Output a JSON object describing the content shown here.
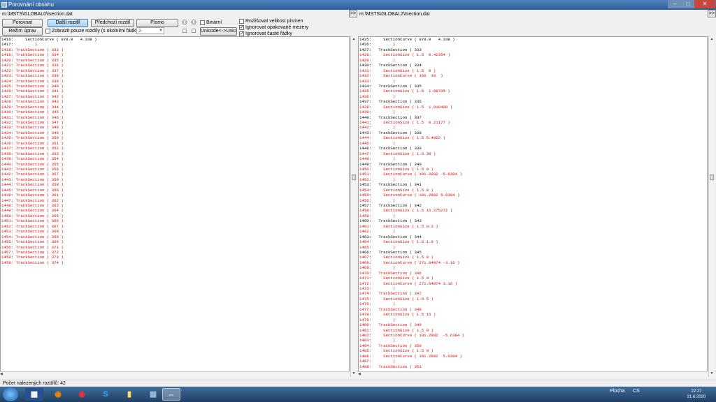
{
  "window": {
    "title": "Porovnání obsahu",
    "minimize": "–",
    "maximize": "□",
    "close": "✕"
  },
  "paths": {
    "left": "m:\\MSTS\\GLOBAL0\\tsection.dat",
    "right": "m:\\MSTS\\GLOBAL2\\tsection.dat",
    "arrow_label": ">>"
  },
  "toolbar": {
    "compare": "Porovnat",
    "next_diff": "Další rozdíl",
    "prev_diff": "Předchozí rozdíl",
    "font": "Písmo",
    "edit_mode": "Režim úprav",
    "unicode": "Unicode<->Unicode",
    "binary": "Binární",
    "only_diff": "Zobrazit pouze rozdíly (s okolními řádky)",
    "context_value": "2",
    "case_sensitive": "Rozlišovat velikost písmen",
    "ignore_spaces": "Ignorovat opakované mezery",
    "ignore_lines": "Ignorovat časté řádky"
  },
  "checks": {
    "binary": false,
    "only_diff": false,
    "case_sensitive": false,
    "ignore_spaces": true,
    "ignore_lines": true
  },
  "left_lines": [
    {
      "n": "1416:",
      "t": "    SectionCurve ( 870.0   4.338 )",
      "d": false
    },
    {
      "n": "1417:",
      "t": "        )",
      "d": false
    },
    {
      "n": "1418:",
      "t": "TrackSection ( 333 )",
      "d": true
    },
    {
      "n": "1419:",
      "t": "TrackSection ( 334 )",
      "d": true
    },
    {
      "n": "1420:",
      "t": "TrackSection ( 335 )",
      "d": true
    },
    {
      "n": "1421:",
      "t": "TrackSection ( 336 )",
      "d": true
    },
    {
      "n": "1422:",
      "t": "TrackSection ( 337 )",
      "d": true
    },
    {
      "n": "1423:",
      "t": "TrackSection ( 338 )",
      "d": true
    },
    {
      "n": "1424:",
      "t": "TrackSection ( 339 )",
      "d": true
    },
    {
      "n": "1425:",
      "t": "TrackSection ( 340 )",
      "d": true
    },
    {
      "n": "1426:",
      "t": "TrackSection ( 341 )",
      "d": true
    },
    {
      "n": "1427:",
      "t": "TrackSection ( 342 )",
      "d": true
    },
    {
      "n": "1428:",
      "t": "TrackSection ( 343 )",
      "d": true
    },
    {
      "n": "1429:",
      "t": "TrackSection ( 344 )",
      "d": true
    },
    {
      "n": "1430:",
      "t": "TrackSection ( 345 )",
      "d": true
    },
    {
      "n": "1431:",
      "t": "TrackSection ( 346 )",
      "d": true
    },
    {
      "n": "1432:",
      "t": "TrackSection ( 347 )",
      "d": true
    },
    {
      "n": "1433:",
      "t": "TrackSection ( 348 )",
      "d": true
    },
    {
      "n": "1434:",
      "t": "TrackSection ( 349 )",
      "d": true
    },
    {
      "n": "1435:",
      "t": "TrackSection ( 350 )",
      "d": true
    },
    {
      "n": "1436:",
      "t": "TrackSection ( 351 )",
      "d": true
    },
    {
      "n": "1437:",
      "t": "TrackSection ( 352 )",
      "d": true
    },
    {
      "n": "1438:",
      "t": "TrackSection ( 353 )",
      "d": true
    },
    {
      "n": "1439:",
      "t": "TrackSection ( 354 )",
      "d": true
    },
    {
      "n": "1440:",
      "t": "TrackSection ( 355 )",
      "d": true
    },
    {
      "n": "1441:",
      "t": "TrackSection ( 356 )",
      "d": true
    },
    {
      "n": "1442:",
      "t": "TrackSection ( 357 )",
      "d": true
    },
    {
      "n": "1443:",
      "t": "TrackSection ( 358 )",
      "d": true
    },
    {
      "n": "1444:",
      "t": "TrackSection ( 359 )",
      "d": true
    },
    {
      "n": "1445:",
      "t": "TrackSection ( 360 )",
      "d": true
    },
    {
      "n": "1446:",
      "t": "TrackSection ( 361 )",
      "d": true
    },
    {
      "n": "1447:",
      "t": "TrackSection ( 362 )",
      "d": true
    },
    {
      "n": "1448:",
      "t": "TrackSection ( 363 )",
      "d": true
    },
    {
      "n": "1449:",
      "t": "TrackSection ( 364 )",
      "d": true
    },
    {
      "n": "1450:",
      "t": "TrackSection ( 365 )",
      "d": true
    },
    {
      "n": "1451:",
      "t": "TrackSection ( 366 )",
      "d": true
    },
    {
      "n": "1452:",
      "t": "TrackSection ( 367 )",
      "d": true
    },
    {
      "n": "1453:",
      "t": "TrackSection ( 368 )",
      "d": true
    },
    {
      "n": "1454:",
      "t": "TrackSection ( 369 )",
      "d": true
    },
    {
      "n": "1455:",
      "t": "TrackSection ( 360 )",
      "d": true
    },
    {
      "n": "1456:",
      "t": "TrackSection ( 371 )",
      "d": true
    },
    {
      "n": "1457:",
      "t": "TrackSection ( 372 )",
      "d": true
    },
    {
      "n": "1458:",
      "t": "TrackSection ( 373 )",
      "d": true
    },
    {
      "n": "1459:",
      "t": "TrackSection ( 374 )",
      "d": true
    }
  ],
  "right_lines": [
    {
      "n": "1425:",
      "t": "    SectionCurve ( 870.0   4.338 )",
      "d": false
    },
    {
      "n": "1426:",
      "t": "        )",
      "d": false
    },
    {
      "n": "1427:",
      "t": "  TrackSection ( 333",
      "d": false
    },
    {
      "n": "1428:",
      "t": "    SectionSize ( 1.5  0.42354 )",
      "d": true
    },
    {
      "n": "1429:",
      "t": "        )",
      "d": true
    },
    {
      "n": "1430:",
      "t": "  TrackSection ( 334",
      "d": false
    },
    {
      "n": "1431:",
      "t": "    SectionSize ( 1.5  0 )",
      "d": true
    },
    {
      "n": "1432:",
      "t": "    SectionCurve ( 160  10  )",
      "d": true
    },
    {
      "n": "1433:",
      "t": "        )",
      "d": true
    },
    {
      "n": "1434:",
      "t": "  TrackSection ( 335",
      "d": false
    },
    {
      "n": "1435:",
      "t": "    SectionSize ( 1.5  1.08705 )",
      "d": true
    },
    {
      "n": "1436:",
      "t": "        )",
      "d": true
    },
    {
      "n": "1437:",
      "t": "  TrackSection ( 336",
      "d": false
    },
    {
      "n": "1438:",
      "t": "    SectionSize ( 1.5  1.019408 )",
      "d": true
    },
    {
      "n": "1439:",
      "t": "        )",
      "d": true
    },
    {
      "n": "1440:",
      "t": "  TrackSection ( 337",
      "d": false
    },
    {
      "n": "1441:",
      "t": "    SectionSize ( 1.5  0.21177 )",
      "d": true
    },
    {
      "n": "1442:",
      "t": "        )",
      "d": true
    },
    {
      "n": "1443:",
      "t": "  TrackSection ( 338",
      "d": false
    },
    {
      "n": "1444:",
      "t": "    SectionSize ( 1.5 5.4922 )",
      "d": true
    },
    {
      "n": "1445:",
      "t": "        )",
      "d": true
    },
    {
      "n": "1446:",
      "t": "  TrackSection ( 339",
      "d": false
    },
    {
      "n": "1447:",
      "t": "    SectionSize ( 1.5 30 )",
      "d": true
    },
    {
      "n": "1448:",
      "t": "        )",
      "d": true
    },
    {
      "n": "1449:",
      "t": "  TrackSection ( 340",
      "d": false
    },
    {
      "n": "1450:",
      "t": "    SectionSize ( 1.5 0 )",
      "d": true
    },
    {
      "n": "1451:",
      "t": "    SectionCurve ( 101.2882 -5.6384 )",
      "d": true
    },
    {
      "n": "1452:",
      "t": "        )",
      "d": true
    },
    {
      "n": "1453:",
      "t": "  TrackSection ( 341",
      "d": false
    },
    {
      "n": "1454:",
      "t": "    SectionSize ( 1.5 0 )",
      "d": true
    },
    {
      "n": "1455:",
      "t": "    SectionCurve ( 101.2882 5.6384 )",
      "d": true
    },
    {
      "n": "1456:",
      "t": "        )",
      "d": true
    },
    {
      "n": "1457:",
      "t": "  TrackSection ( 342",
      "d": false
    },
    {
      "n": "1458:",
      "t": "    SectionSize ( 1.5 15.275272 )",
      "d": true
    },
    {
      "n": "1459:",
      "t": "        )",
      "d": true
    },
    {
      "n": "1460:",
      "t": "  TrackSection ( 343",
      "d": false
    },
    {
      "n": "1461:",
      "t": "    SectionSize ( 1.5 0.3 )",
      "d": true
    },
    {
      "n": "1462:",
      "t": "        )",
      "d": true
    },
    {
      "n": "1463:",
      "t": "  TrackSection ( 344",
      "d": false
    },
    {
      "n": "1464:",
      "t": "    SectionSize ( 1.5 1.0 )",
      "d": true
    },
    {
      "n": "1465:",
      "t": "        )",
      "d": true
    },
    {
      "n": "1466:",
      "t": "  TrackSection ( 345",
      "d": false
    },
    {
      "n": "1467:",
      "t": "    SectionSize ( 1.5 0 )",
      "d": true
    },
    {
      "n": "1468:",
      "t": "    SectionCurve ( 271.64074 -3.16 )",
      "d": true
    },
    {
      "n": "1469:",
      "t": "        )",
      "d": true
    },
    {
      "n": "1470:",
      "t": "  TrackSection ( 346",
      "d": true
    },
    {
      "n": "1471:",
      "t": "    SectionSize ( 1.5 0 )",
      "d": true
    },
    {
      "n": "1472:",
      "t": "    SectionCurve ( 271.64074 3.16 )",
      "d": true
    },
    {
      "n": "1473:",
      "t": "        )",
      "d": true
    },
    {
      "n": "1474:",
      "t": "  TrackSection ( 347",
      "d": true
    },
    {
      "n": "1475:",
      "t": "    SectionSize ( 1.5 5 )",
      "d": true
    },
    {
      "n": "1476:",
      "t": "        )",
      "d": true
    },
    {
      "n": "1477:",
      "t": "  TrackSection ( 348",
      "d": true
    },
    {
      "n": "1478:",
      "t": "    SectionSize ( 1.5 15 )",
      "d": true
    },
    {
      "n": "1479:",
      "t": "        )",
      "d": true
    },
    {
      "n": "1480:",
      "t": "  TrackSection ( 349",
      "d": true
    },
    {
      "n": "1481:",
      "t": "    SectionSize ( 1.5 0 )",
      "d": true
    },
    {
      "n": "1482:",
      "t": "    SectionCurve ( 101.2882  -5.6384 )",
      "d": true
    },
    {
      "n": "1483:",
      "t": "        )",
      "d": true
    },
    {
      "n": "1484:",
      "t": "  TrackSection ( 350",
      "d": true
    },
    {
      "n": "1485:",
      "t": "    SectionSize ( 1.5 0 )",
      "d": true
    },
    {
      "n": "1486:",
      "t": "    SectionCurve ( 101.2882  5.6384 )",
      "d": true
    },
    {
      "n": "1487:",
      "t": "        )",
      "d": true
    },
    {
      "n": "1488:",
      "t": "  TrackSection ( 351",
      "d": true
    }
  ],
  "status": {
    "text": "Počet nalezených rozdílů: 42"
  },
  "taskbar": {
    "tray_text": "Plocha",
    "lang": "CS",
    "time": "22:27",
    "date": "21.6.2020"
  }
}
